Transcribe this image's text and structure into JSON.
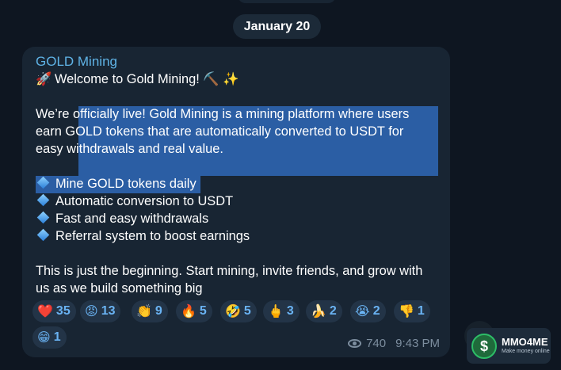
{
  "date": "January 20",
  "message": {
    "sender": "GOLD Mining",
    "welcome": "Welcome to Gold Mining! ⛏️ ✨",
    "intro": [
      "We’re officially live! Gold Mining is a mining platform where users",
      "earn GOLD tokens that are automatically converted to USDT for",
      "easy withdrawals and real value."
    ],
    "features": [
      "Mine GOLD tokens daily",
      "Automatic conversion to USDT",
      "Fast and easy withdrawals",
      "Referral system to boost earnings"
    ],
    "closing": [
      "This is just the beginning. Start mining, invite friends, and grow with",
      "us as we build something big"
    ],
    "views": "740",
    "time": "9:43 PM"
  },
  "reactions": [
    {
      "emoji": "❤️",
      "count": "35"
    },
    {
      "emoji": "😡",
      "count": "13"
    },
    {
      "emoji": "👏",
      "count": "9"
    },
    {
      "emoji": "🔥",
      "count": "5"
    },
    {
      "emoji": "🤣",
      "count": "5"
    },
    {
      "emoji": "🖕",
      "count": "3"
    },
    {
      "emoji": "🍌",
      "count": "2"
    },
    {
      "emoji": "😭",
      "count": "2"
    },
    {
      "emoji": "👎",
      "count": "1"
    },
    {
      "emoji": "😁",
      "count": "1"
    }
  ],
  "watermark": {
    "coin": "$",
    "title": "MMO4ME",
    "subtitle": "Make money online"
  },
  "colors": {
    "background": "#0e1621",
    "bubble": "#182533",
    "sender": "#5fb3e6",
    "selection": "#2b5ea4",
    "reaction_count": "#6ab3f3"
  }
}
